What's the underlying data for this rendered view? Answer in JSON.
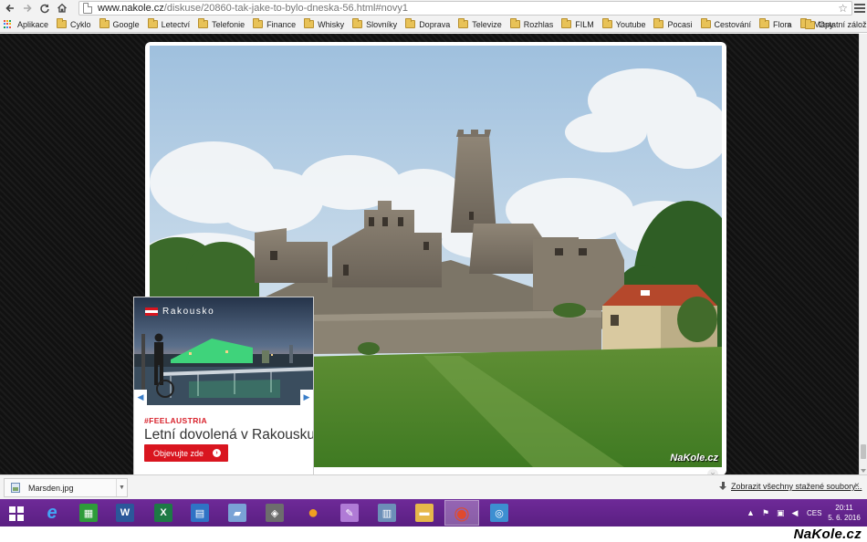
{
  "browser": {
    "url_host": "www.nakole.cz",
    "url_path": "/diskuse/20860-tak-jake-to-bylo-dneska-56.html#novy1",
    "bookmarks": [
      {
        "label": "Aplikace",
        "kind": "apps"
      },
      {
        "label": "Cyklo",
        "kind": "folder"
      },
      {
        "label": "Google",
        "kind": "folder"
      },
      {
        "label": "Letectví",
        "kind": "folder"
      },
      {
        "label": "Telefonie",
        "kind": "folder"
      },
      {
        "label": "Finance",
        "kind": "folder"
      },
      {
        "label": "Whisky",
        "kind": "folder"
      },
      {
        "label": "Slovníky",
        "kind": "folder"
      },
      {
        "label": "Doprava",
        "kind": "folder"
      },
      {
        "label": "Televize",
        "kind": "folder"
      },
      {
        "label": "Rozhlas",
        "kind": "folder"
      },
      {
        "label": "FILM",
        "kind": "folder"
      },
      {
        "label": "Youtube",
        "kind": "folder"
      },
      {
        "label": "Pocasi",
        "kind": "folder"
      },
      {
        "label": "Cestování",
        "kind": "folder"
      },
      {
        "label": "Flora",
        "kind": "folder"
      },
      {
        "label": "Mapy",
        "kind": "folder"
      }
    ],
    "bookmarks_more": "»",
    "other_bookmarks": "Ostatní záložky"
  },
  "page": {
    "photo_watermark": "NaKole.cz"
  },
  "ad": {
    "brand": "Rakousko",
    "tag": "#FEELAUSTRIA",
    "headline": "Letní dovolená v Rakousku",
    "cta": "Objevujte zde",
    "flag_colors": [
      "#d9151f",
      "#ffffff",
      "#d9151f"
    ]
  },
  "download_shelf": {
    "file_name": "Marsden.jpg",
    "show_all": "Zobrazit všechny stažené soubory...",
    "close": "×"
  },
  "taskbar": {
    "apps": [
      {
        "name": "internet-explorer-icon",
        "glyph": "e",
        "color": "#1e88e5"
      },
      {
        "name": "store-icon",
        "glyph": "▦",
        "color": "#2e9c3a"
      },
      {
        "name": "word-icon",
        "glyph": "W",
        "color": "#2b579a"
      },
      {
        "name": "excel-icon",
        "glyph": "X",
        "color": "#1d7a45"
      },
      {
        "name": "scanner-icon",
        "glyph": "▤",
        "color": "#2f73c5"
      },
      {
        "name": "notes-icon",
        "glyph": "▰",
        "color": "#7aa3d6"
      },
      {
        "name": "media-icon",
        "glyph": "◈",
        "color": "#6d6d6d"
      },
      {
        "name": "orange-ball-icon",
        "glyph": "●",
        "color": "#f0a020"
      },
      {
        "name": "paint-icon",
        "glyph": "✎",
        "color": "#b07bd6"
      },
      {
        "name": "calculator-icon",
        "glyph": "▥",
        "color": "#6c8fb8"
      },
      {
        "name": "file-explorer-icon",
        "glyph": "▬",
        "color": "#e6b84a"
      },
      {
        "name": "chrome-icon",
        "glyph": "◉",
        "color": "#e04a2e"
      },
      {
        "name": "remote-icon",
        "glyph": "◎",
        "color": "#3d8fd1"
      }
    ],
    "language": "CES",
    "time": "20:11",
    "date": "5. 6. 2016"
  },
  "overlay": {
    "corner_logo": "NaKole.cz"
  }
}
